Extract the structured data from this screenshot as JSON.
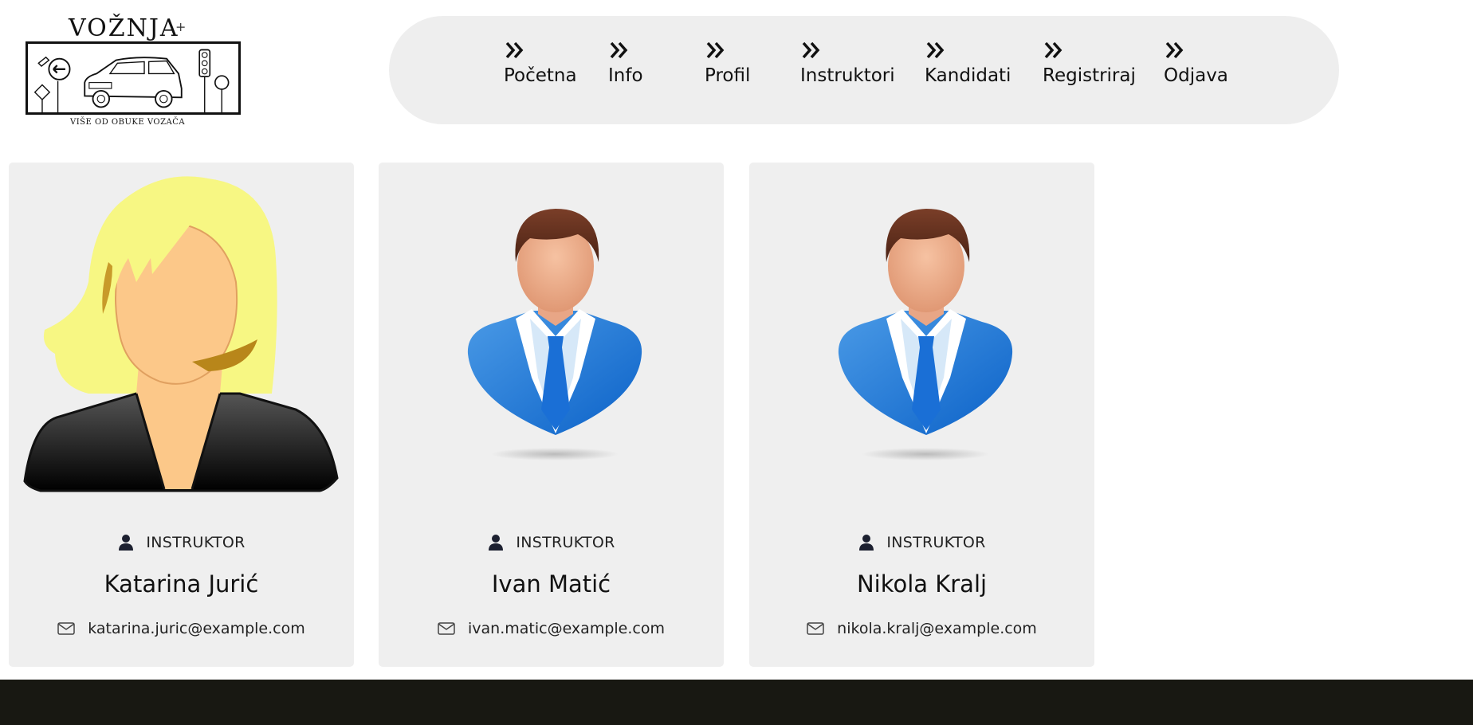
{
  "logo": {
    "title": "VOŽNJA",
    "plus": "+",
    "tagline": "VIŠE OD OBUKE VOZAČA"
  },
  "nav": {
    "items": [
      {
        "label": "Početna",
        "icon": "double-chevron-right-icon"
      },
      {
        "label": "Info",
        "icon": "double-chevron-right-icon"
      },
      {
        "label": "Profil",
        "icon": "double-chevron-right-icon"
      },
      {
        "label": "Instruktori",
        "icon": "double-chevron-right-icon"
      },
      {
        "label": "Kandidati",
        "icon": "double-chevron-right-icon"
      },
      {
        "label": "Registriraj",
        "icon": "double-chevron-right-icon"
      },
      {
        "label": "Odjava",
        "icon": "double-chevron-right-icon"
      }
    ]
  },
  "cards": [
    {
      "role": "INSTRUKTOR",
      "name": "Katarina Jurić",
      "email": "katarina.juric@example.com",
      "avatar": "female-avatar"
    },
    {
      "role": "INSTRUKTOR",
      "name": "Ivan Matić",
      "email": "ivan.matic@example.com",
      "avatar": "male-avatar"
    },
    {
      "role": "INSTRUKTOR",
      "name": "Nikola Kralj",
      "email": "nikola.kralj@example.com",
      "avatar": "male-avatar"
    }
  ],
  "colors": {
    "navbar_bg": "#eeeeee",
    "card_bg": "#efefef",
    "footer_bg": "#181812",
    "suit_blue": "#1a6fd6"
  }
}
